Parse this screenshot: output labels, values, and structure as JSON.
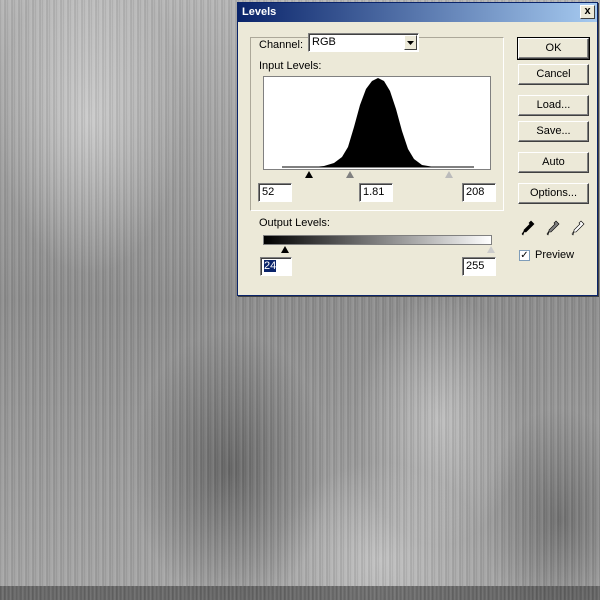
{
  "dialog": {
    "title": "Levels",
    "close_label": "x",
    "channel": {
      "label": "Channel:",
      "value": "RGB"
    },
    "input_levels": {
      "label": "Input Levels:",
      "black": "52",
      "gamma": "1.81",
      "white": "208"
    },
    "output_levels": {
      "label": "Output Levels:",
      "black": "24",
      "white": "255"
    },
    "buttons": {
      "ok": "OK",
      "cancel": "Cancel",
      "load": "Load...",
      "save": "Save...",
      "auto": "Auto",
      "options": "Options..."
    },
    "preview": {
      "label": "Preview",
      "checked": true
    },
    "icons": [
      "black-eyedropper-icon",
      "gray-eyedropper-icon",
      "white-eyedropper-icon"
    ]
  }
}
